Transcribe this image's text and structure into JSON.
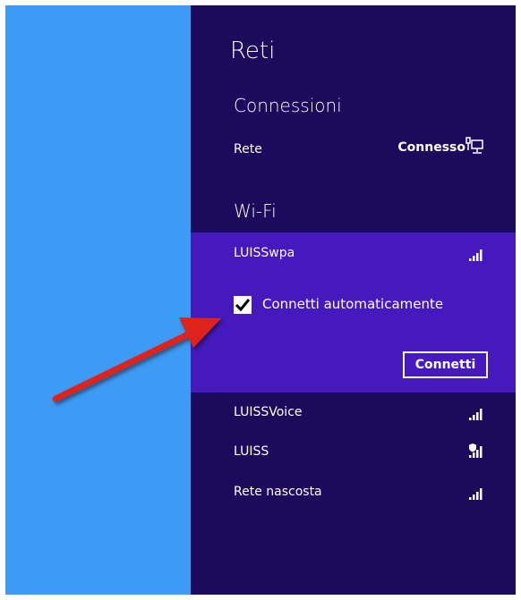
{
  "panel": {
    "title": "Reti",
    "connections_heading": "Connessioni",
    "ethernet": {
      "name": "Rete",
      "status": "Connesso"
    },
    "wifi_heading": "Wi-Fi",
    "selected_network": {
      "name": "LUISSwpa",
      "auto_connect_label": "Connetti automaticamente",
      "auto_connect_checked": true,
      "connect_button": "Connetti"
    },
    "networks": [
      {
        "name": "LUISSVoice",
        "secured": false
      },
      {
        "name": "LUISS",
        "secured": true
      },
      {
        "name": "Rete nascosta",
        "secured": false
      }
    ]
  },
  "colors": {
    "panel_bg": "#1c0a5c",
    "selected_bg": "#4519bd",
    "desktop_bg": "#3d9bf5",
    "arrow": "#e0201b"
  }
}
